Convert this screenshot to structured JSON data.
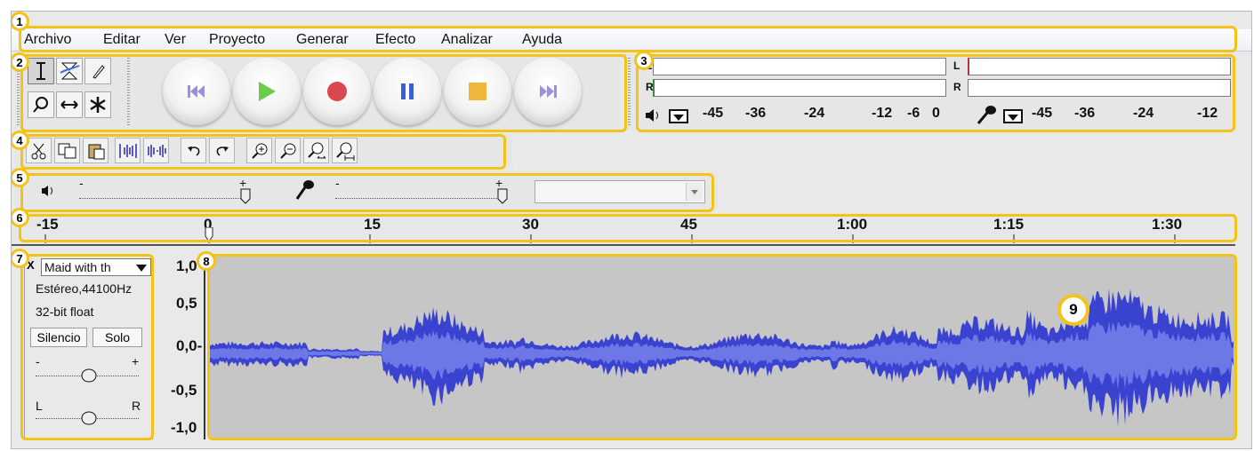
{
  "menu": [
    "Archivo",
    "Editar",
    "Ver",
    "Proyecto",
    "Generar",
    "Efecto",
    "Analizar",
    "Ayuda"
  ],
  "callouts": [
    "1",
    "2",
    "3",
    "4",
    "5",
    "6",
    "7",
    "8",
    "9"
  ],
  "tools": {
    "top": [
      "selection-tool-icon",
      "envelope-tool-icon",
      "draw-tool-icon"
    ],
    "bottom": [
      "zoom-tool-icon",
      "timeshift-tool-icon",
      "multi-tool-icon"
    ]
  },
  "transport": [
    {
      "name": "skip-start",
      "icon": "skip-start-icon",
      "color": "#9c8fe0"
    },
    {
      "name": "play",
      "icon": "play-icon",
      "color": "#6ccb4a"
    },
    {
      "name": "record",
      "icon": "record-icon",
      "color": "#d9484c"
    },
    {
      "name": "pause",
      "icon": "pause-icon",
      "color": "#3b5fd8"
    },
    {
      "name": "stop",
      "icon": "stop-icon",
      "color": "#efb63a"
    },
    {
      "name": "skip-end",
      "icon": "skip-end-icon",
      "color": "#9c8fe0"
    }
  ],
  "meters": {
    "channel_left": "L",
    "channel_right": "R",
    "play_scale": [
      "-45",
      "-36",
      "-24",
      "-12",
      "-6",
      "0"
    ],
    "rec_scale": [
      "-45",
      "-36",
      "-24",
      "-12"
    ]
  },
  "mixer": {
    "minus": "-",
    "plus": "+",
    "device_value": ""
  },
  "ruler": {
    "labels": [
      "-15",
      "0",
      "15",
      "30",
      "45",
      "1:00",
      "1:15",
      "1:30"
    ]
  },
  "track": {
    "close": "X",
    "name": "Maid with th",
    "format": "Estéreo,44100Hz",
    "bits": "32-bit float",
    "mute": "Silencio",
    "solo": "Solo",
    "gain_minus": "-",
    "gain_plus": "+",
    "pan_left": "L",
    "pan_right": "R",
    "scale": [
      "1,0",
      "0,5",
      "0,0-",
      "-0,5",
      "-1,0"
    ]
  },
  "colors": {
    "callout": "#f3c317",
    "waveform": "#3a43d0",
    "waveform_rms": "#6d77e6",
    "waveform_bg": "#c6c6c6"
  }
}
